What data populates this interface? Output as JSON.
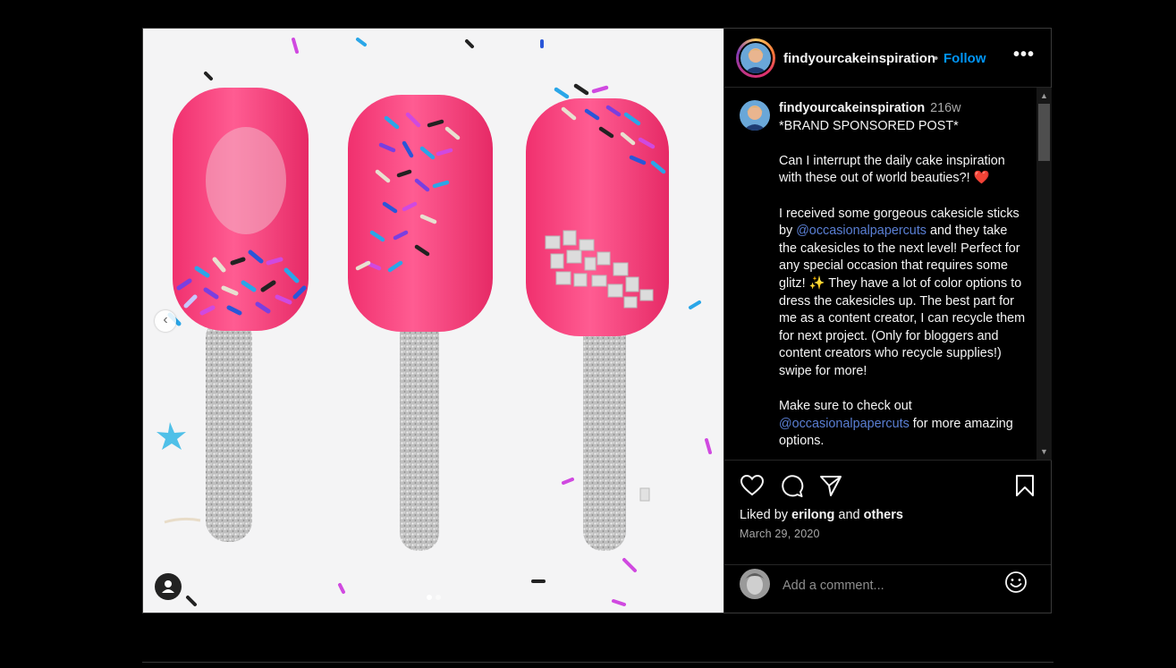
{
  "post": {
    "username": "findyourcakeinspiration",
    "follow_label": "Follow",
    "separator": "•",
    "more_label": "•••",
    "prev_label": "‹"
  },
  "caption": {
    "username": "findyourcakeinspiration",
    "time": "216w",
    "lines": {
      "l1": "*BRAND SPONSORED POST*",
      "l2": "Can I interrupt the daily cake inspiration with these out of world beauties?! ❤️",
      "l3a": "I received some gorgeous cakesicle sticks by ",
      "l3m": "@occasionalpapercuts",
      "l3b": " and they take the cakesicles to the next level! Perfect for any special occasion that requires some glitz! ✨ They have a lot of color options to dress the cakesicles up. The best part for me as a content creator, I can recycle them for next project. (Only for bloggers and content creators who recycle supplies!) swipe for more!",
      "l4a": "Make sure to check out ",
      "l4m": "@occasionalpapercuts",
      "l4b": " for more amazing options."
    }
  },
  "engagement": {
    "liked_prefix": "Liked by ",
    "liked_user": "erilong",
    "liked_and": " and ",
    "liked_others": "others",
    "date": "March 29, 2020"
  },
  "comment": {
    "placeholder": "Add a comment..."
  },
  "icons": {
    "like": "heart-icon",
    "comment": "comment-icon",
    "share": "share-icon",
    "save": "bookmark-icon",
    "emoji": "smiley-icon"
  },
  "colors": {
    "accent": "#0095f6",
    "mention": "#5a7fd4",
    "pink": "#ff4f8b"
  },
  "carousel": {
    "count": 2,
    "active": 1
  }
}
